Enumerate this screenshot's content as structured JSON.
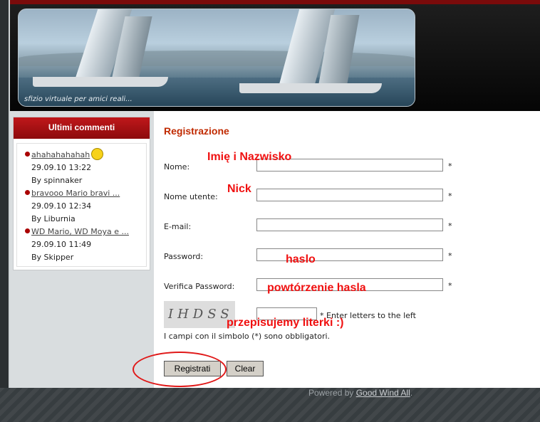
{
  "header": {
    "tagline": "sfizio virtuale per amici reali..."
  },
  "sidebar": {
    "title": "Ultimi commenti",
    "comments": [
      {
        "link": "ahahahahahah",
        "date": "29.09.10 13:22",
        "author": "By spinnaker"
      },
      {
        "link": "bravooo Mario bravi ...",
        "date": "29.09.10 12:34",
        "author": "By Liburnia"
      },
      {
        "link": "WD Mario, WD Moya e ...",
        "date": "29.09.10 11:49",
        "author": "By Skipper"
      }
    ]
  },
  "form": {
    "title": "Registrazione",
    "labels": {
      "name": "Nome:",
      "username": "Nome utente:",
      "email": "E-mail:",
      "password": "Password:",
      "verify_password": "Verifica Password:"
    },
    "required_mark": "*",
    "captcha_hint": "* Enter letters to the left",
    "captcha_text": "IHDSS",
    "required_note": "I campi con il simbolo (*) sono obbligatori.",
    "register_button": "Registrati",
    "clear_button": "Clear"
  },
  "annotations": {
    "name": "Imię i Nazwisko",
    "username": "Nick",
    "password": "haslo",
    "verify_password": "powtórzenie hasla",
    "captcha": "przepisujemy literki :)"
  },
  "footer": {
    "prefix": "Powered by",
    "link": "Good Wind All",
    "suffix": "."
  }
}
